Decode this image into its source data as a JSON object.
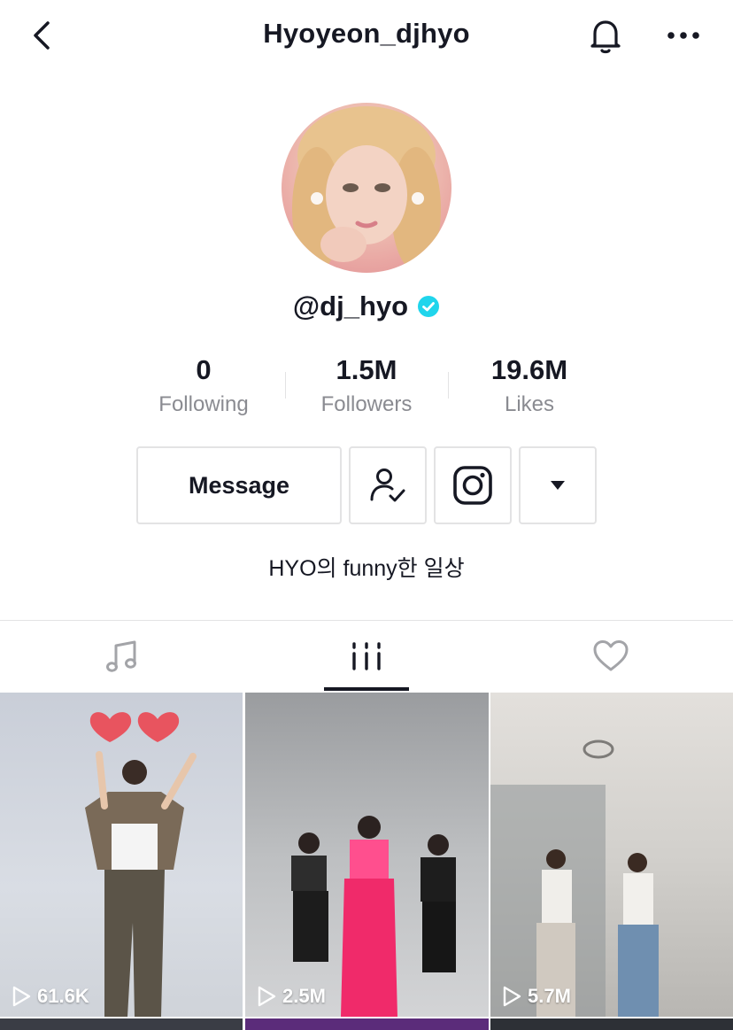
{
  "header": {
    "title": "Hyoyeon_djhyo",
    "back_icon": "chevron-left-icon",
    "bell_icon": "bell-icon",
    "more_icon": "more-horizontal-icon"
  },
  "profile": {
    "handle": "@dj_hyo",
    "verified_icon": "verified-badge-icon",
    "verified_color": "#20D5EC",
    "bio": "HYO의 funny한 일상"
  },
  "stats": [
    {
      "value": "0",
      "label": "Following"
    },
    {
      "value": "1.5M",
      "label": "Followers"
    },
    {
      "value": "19.6M",
      "label": "Likes"
    }
  ],
  "actions": {
    "message_label": "Message",
    "friends_icon": "friends-check-icon",
    "instagram_icon": "instagram-icon",
    "dropdown_icon": "triangle-down-icon"
  },
  "tabs": [
    {
      "icon": "music-note-icon",
      "active": false
    },
    {
      "icon": "videos-grid-icon",
      "active": true
    },
    {
      "icon": "heart-outline-icon",
      "active": false
    }
  ],
  "videos": [
    {
      "views": "61.6K"
    },
    {
      "views": "2.5M"
    },
    {
      "views": "5.7M"
    }
  ],
  "colors": {
    "text": "#161823",
    "secondary": "#8A8B91",
    "border": "#E3E3E4"
  }
}
